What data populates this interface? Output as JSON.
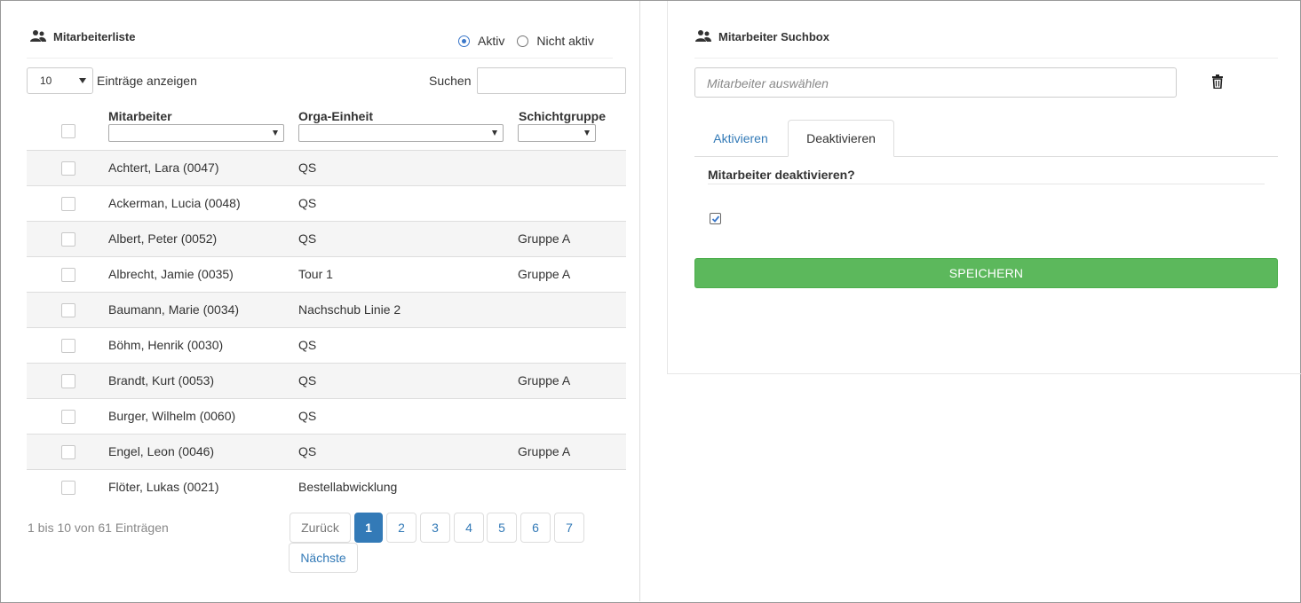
{
  "list_panel": {
    "title": "Mitarbeiterliste",
    "filter_status": {
      "options": [
        "Aktiv",
        "Nicht aktiv"
      ],
      "selected": "Aktiv"
    },
    "page_length": {
      "value": "10",
      "label": "Einträge anzeigen"
    },
    "search": {
      "label": "Suchen",
      "value": ""
    },
    "columns": [
      "Mitarbeiter",
      "Orga-Einheit",
      "Schichtgruppe"
    ],
    "rows": [
      {
        "name": "Achtert, Lara (0047)",
        "org": "QS",
        "group": ""
      },
      {
        "name": "Ackerman, Lucia (0048)",
        "org": "QS",
        "group": ""
      },
      {
        "name": "Albert, Peter (0052)",
        "org": "QS",
        "group": "Gruppe A"
      },
      {
        "name": "Albrecht, Jamie (0035)",
        "org": "Tour 1",
        "group": "Gruppe A"
      },
      {
        "name": "Baumann, Marie (0034)",
        "org": "Nachschub Linie 2",
        "group": ""
      },
      {
        "name": "Böhm, Henrik (0030)",
        "org": "QS",
        "group": ""
      },
      {
        "name": "Brandt, Kurt (0053)",
        "org": "QS",
        "group": "Gruppe A"
      },
      {
        "name": "Burger, Wilhelm (0060)",
        "org": "QS",
        "group": ""
      },
      {
        "name": "Engel, Leon (0046)",
        "org": "QS",
        "group": "Gruppe A"
      },
      {
        "name": "Flöter, Lukas (0021)",
        "org": "Bestellabwicklung",
        "group": ""
      }
    ],
    "info": "1 bis 10 von 61 Einträgen",
    "pagination": {
      "prev": "Zurück",
      "pages": [
        "1",
        "2",
        "3",
        "4",
        "5",
        "6",
        "7"
      ],
      "current": "1",
      "next": "Nächste"
    }
  },
  "search_panel": {
    "title": "Mitarbeiter Suchbox",
    "employee_placeholder": "Mitarbeiter auswählen",
    "tabs": [
      "Aktivieren",
      "Deaktivieren"
    ],
    "active_tab": "Deaktivieren",
    "question": "Mitarbeiter deaktivieren?",
    "confirm_checked": true,
    "save_label": "SPEICHERN"
  },
  "colors": {
    "primary": "#337ab7",
    "success": "#5cb85c",
    "stripe": "#f5f5f5"
  }
}
